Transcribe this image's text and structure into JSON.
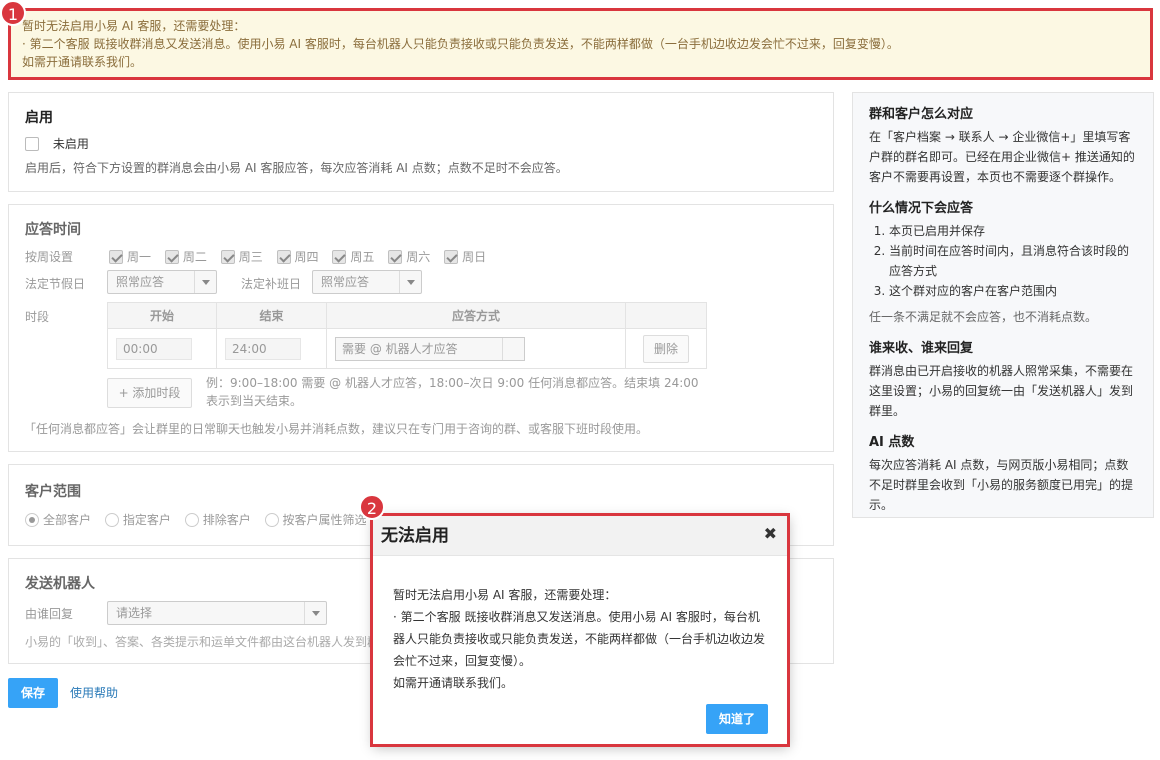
{
  "markers": [
    "1",
    "2"
  ],
  "alert": {
    "line1": "暂时无法启用小易 AI 客服，还需要处理：",
    "line2": "· 第二个客服 既接收群消息又发送消息。使用小易 AI 客服时，每台机器人只能负责接收或只能负责发送，不能两样都做（一台手机边收边发会忙不过来，回复变慢）。",
    "line3": "如需开通请联系我们。"
  },
  "enable": {
    "title": "启用",
    "checkbox_label": "未启用",
    "checked": false,
    "desc": "启用后，符合下方设置的群消息会由小易 AI 客服应答，每次应答消耗 AI 点数；点数不足时不会应答。"
  },
  "schedule": {
    "title": "应答时间",
    "weekday_label": "按周设置",
    "days": [
      "周一",
      "周二",
      "周三",
      "周四",
      "周五",
      "周六",
      "周日"
    ],
    "holiday_label": "法定节假日",
    "holiday_value": "照常应答",
    "workday_label": "法定补班日",
    "workday_value": "照常应答",
    "period_label": "时段",
    "headers": [
      "开始",
      "结束",
      "应答方式",
      ""
    ],
    "row": {
      "start": "00:00",
      "end": "24:00",
      "mode": "需要 @ 机器人才应答",
      "delete": "删除"
    },
    "add_label": "+ 添加时段",
    "example": "例：9:00–18:00 需要 @ 机器人才应答，18:00–次日 9:00 任何消息都应答。结束填 24:00 表示到当天结束。",
    "note": "「任何消息都应答」会让群里的日常聊天也触发小易并消耗点数，建议只在专门用于咨询的群、或客服下班时段使用。"
  },
  "scope": {
    "title": "客户范围",
    "options": [
      "全部客户",
      "指定客户",
      "排除客户",
      "按客户属性筛选"
    ],
    "selected": 0
  },
  "robot": {
    "title": "发送机器人",
    "label": "由谁回复",
    "placeholder": "请选择",
    "desc": "小易的「收到」、答案、各类提示和运单文件都由这台机器人发到群里。"
  },
  "footer": {
    "save": "保存",
    "help": "使用帮助"
  },
  "side": {
    "h1": "群和客户怎么对应",
    "p1": "在「客户档案 → 联系人 → 企业微信+」里填写客户群的群名即可。已经在用企业微信+ 推送通知的客户不需要再设置，本页也不需要逐个群操作。",
    "h2": "什么情况下会应答",
    "items": [
      "本页已启用并保存",
      "当前时间在应答时间内，且消息符合该时段的应答方式",
      "这个群对应的客户在客户范围内"
    ],
    "p2": "任一条不满足就不会应答，也不消耗点数。",
    "h3": "谁来收、谁来回复",
    "p3": "群消息由已开启接收的机器人照常采集，不需要在这里设置；小易的回复统一由「发送机器人」发到群里。",
    "h4": "AI 点数",
    "p4": "每次应答消耗 AI 点数，与网页版小易相同；点数不足时群里会收到「小易的服务额度已用完」的提示。"
  },
  "modal": {
    "title": "无法启用",
    "line1": "暂时无法启用小易 AI 客服，还需要处理：",
    "line2": "· 第二个客服 既接收群消息又发送消息。使用小易 AI 客服时，每台机器人只能负责接收或只能负责发送，不能两样都做（一台手机边收边发会忙不过来，回复变慢）。",
    "line3": "如需开通请联系我们。",
    "ok": "知道了"
  }
}
